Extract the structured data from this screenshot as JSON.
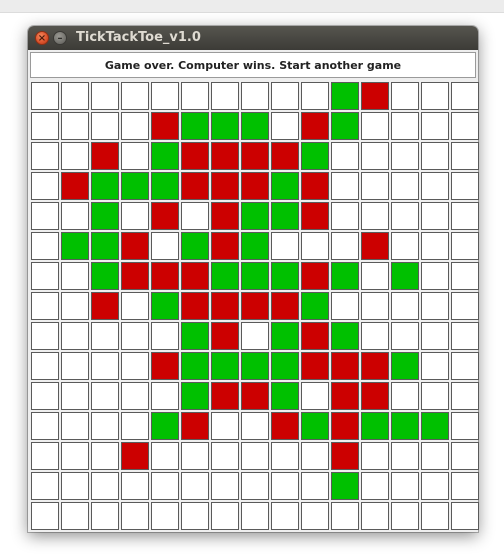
{
  "window": {
    "title": "TickTackToe_v1.0",
    "close_icon": "close-icon",
    "minimize_icon": "minimize-icon"
  },
  "status": {
    "message": "Game over. Computer wins. Start another game"
  },
  "colors": {
    "G": "#00c000",
    "R": "#cc0000",
    "empty": "#ffffff",
    "cell_border": "#5a5a5a"
  },
  "board": {
    "size": 15,
    "legend": {
      "G": "green piece",
      "R": "red piece",
      ".": "empty"
    },
    "rows": [
      "..........GR...",
      "....RGGG.RG....",
      "..R.GRRRRG.....",
      ".RGGGRRRGR.....",
      "..G.R.RGGR.....",
      ".GGR.GRG...R...",
      "..GRRRGGGRG.G..",
      "..R.GRRRRG.....",
      ".....GR.GRG....",
      "....RGGGGRRRG..",
      ".....GRRG.RR...",
      "....GR..RGRGGG.",
      "...R......R....",
      "..........G....",
      "..............."
    ]
  }
}
